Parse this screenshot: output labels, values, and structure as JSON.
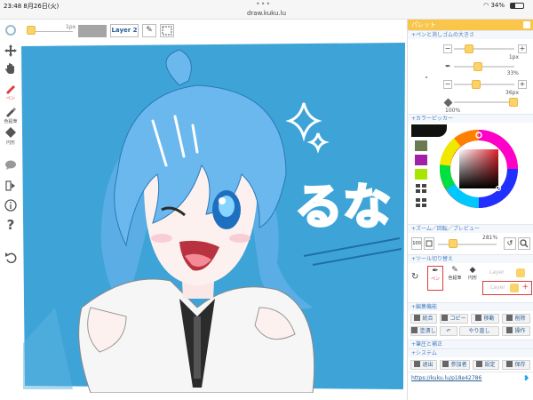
{
  "status": {
    "time": "23:48",
    "date": "8月26日(火)",
    "url": "draw.kuku.lu",
    "battery": "34%"
  },
  "toolbar": {
    "size_value": "1px",
    "layer_label": "Layer 2"
  },
  "left_tools": {
    "pen_label": "ペン",
    "brush_label": "色鉛筆",
    "shape_label": "円形"
  },
  "panel": {
    "title": "パレット",
    "sections": {
      "pen_size": "+ペンと消しゴムの大きさ",
      "color_picker": "+カラーピッカー",
      "zoom": "+ズーム／回転／プレビュー",
      "tool_switch": "+ツール切り替え",
      "edit": "+編集機能",
      "correct": "+筆圧と補正",
      "system": "+システム"
    },
    "pen_size_value": "1px",
    "opacity_value": "33%",
    "eraser_size_value": "36px",
    "eraser_opacity_value": "100%",
    "zoom_value": "100",
    "zoom_percent": "281%",
    "tool_labels": {
      "pen": "ペン",
      "brush": "色鉛筆",
      "shape": "円形"
    },
    "layers": [
      "Layer",
      "Layer"
    ],
    "edit_buttons": [
      "統合",
      "コピー",
      "移動",
      "削除",
      "塗潰し",
      "やり直し",
      "操作"
    ],
    "system_buttons": [
      "退出",
      "参加者",
      "設定",
      "保存"
    ],
    "share_url": "https://kuku.lu/p18e42786"
  },
  "canvas": {
    "text": "るな"
  },
  "colors": {
    "accent": "#f9c54a",
    "canvas_bg": "#3ea4d8",
    "swatch_green": "#6b7a52",
    "swatch_purple": "#a020a8",
    "swatch_lime": "#a6e600",
    "link": "#2b5d96"
  }
}
